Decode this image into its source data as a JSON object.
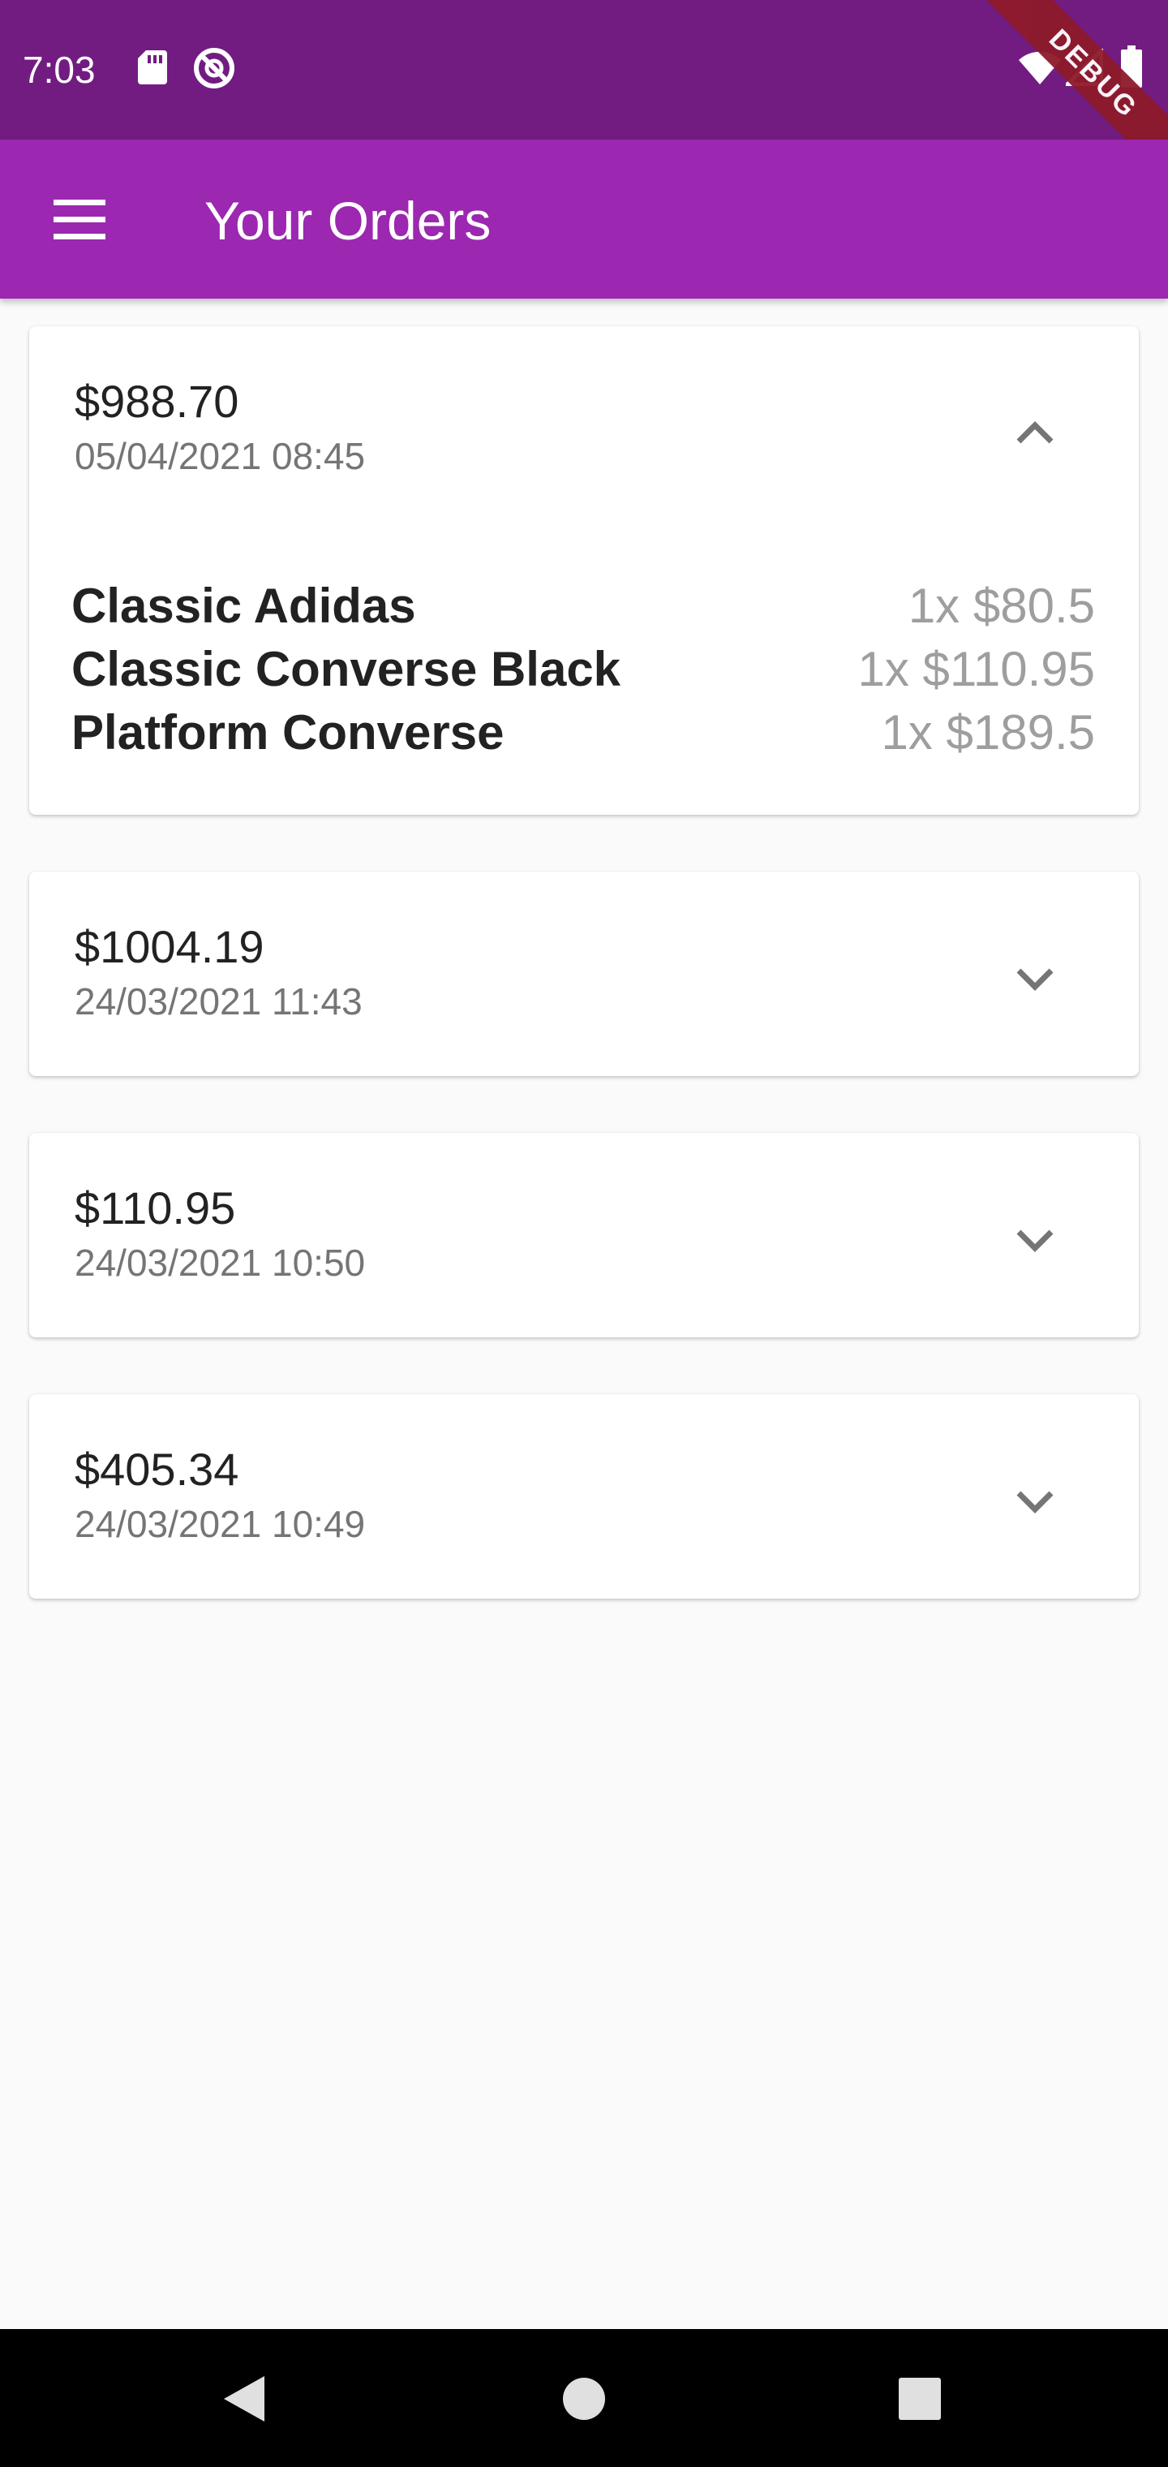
{
  "status_bar": {
    "time": "7:03",
    "debug_label": "DEBUG",
    "icons": [
      "sd-card-icon",
      "sync-icon",
      "wifi-icon",
      "signal-icon",
      "battery-icon"
    ]
  },
  "app_bar": {
    "title": "Your Orders",
    "menu_icon": "menu-icon"
  },
  "orders": [
    {
      "amount": "$988.70",
      "date": "05/04/2021 08:45",
      "expanded": true,
      "items": [
        {
          "name": "Classic Adidas",
          "qty_price": "1x $80.5"
        },
        {
          "name": "Classic Converse Black",
          "qty_price": "1x $110.95"
        },
        {
          "name": "Platform Converse",
          "qty_price": "1x $189.5"
        }
      ]
    },
    {
      "amount": "$1004.19",
      "date": "24/03/2021 11:43",
      "expanded": false
    },
    {
      "amount": "$110.95",
      "date": "24/03/2021 10:50",
      "expanded": false
    },
    {
      "amount": "$405.34",
      "date": "24/03/2021 10:49",
      "expanded": false
    }
  ],
  "colors": {
    "status_bar": "#721c82",
    "app_bar": "#9c27b0",
    "background": "#fafafa",
    "secondary_text": "#757575",
    "debug_ribbon": "#8e1a2a"
  }
}
